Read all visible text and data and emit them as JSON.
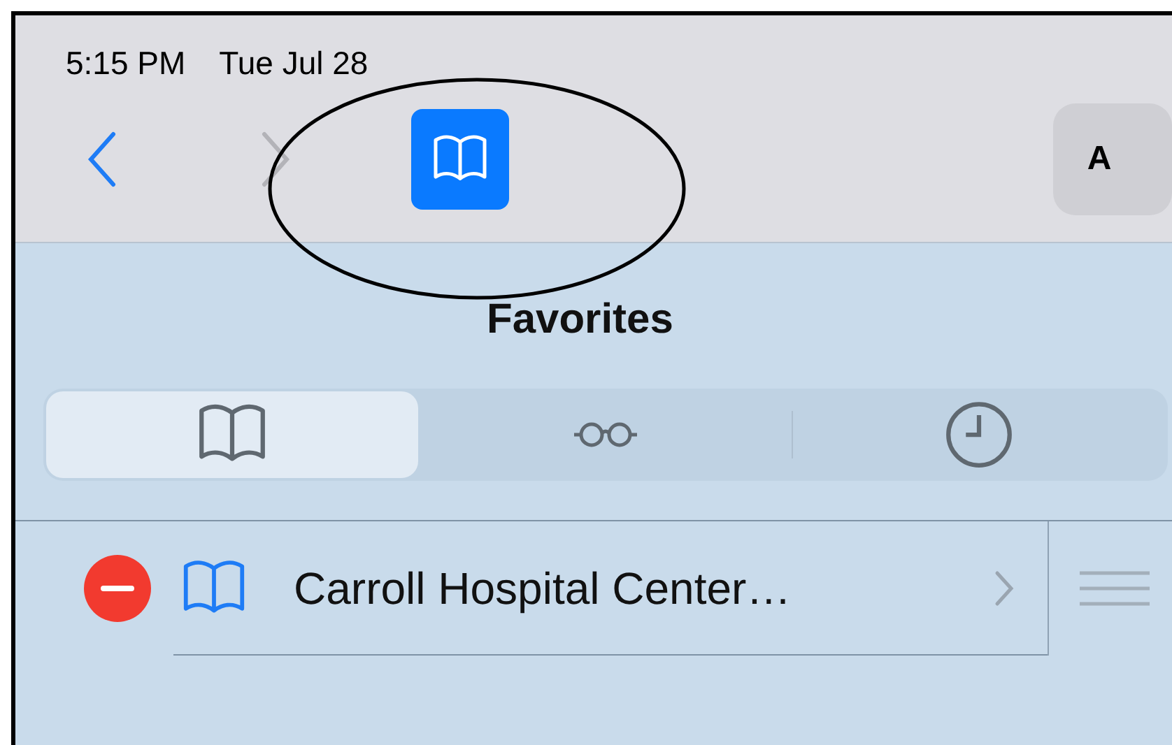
{
  "status_bar": {
    "time": "5:15 PM",
    "date": "Tue Jul 28"
  },
  "toolbar": {
    "back": {
      "disabled": false
    },
    "forward": {
      "disabled": true
    },
    "sidebar_button": {
      "selected": true
    },
    "reader_button": {
      "label": "A"
    }
  },
  "annotation": {
    "kind": "ellipse"
  },
  "sidebar": {
    "title": "Favorites",
    "segments": [
      {
        "kind": "book",
        "selected": true
      },
      {
        "kind": "glasses",
        "selected": false
      },
      {
        "kind": "clock",
        "selected": false
      }
    ],
    "items": [
      {
        "kind": "book",
        "title": "Carroll Hospital Center…"
      }
    ]
  }
}
